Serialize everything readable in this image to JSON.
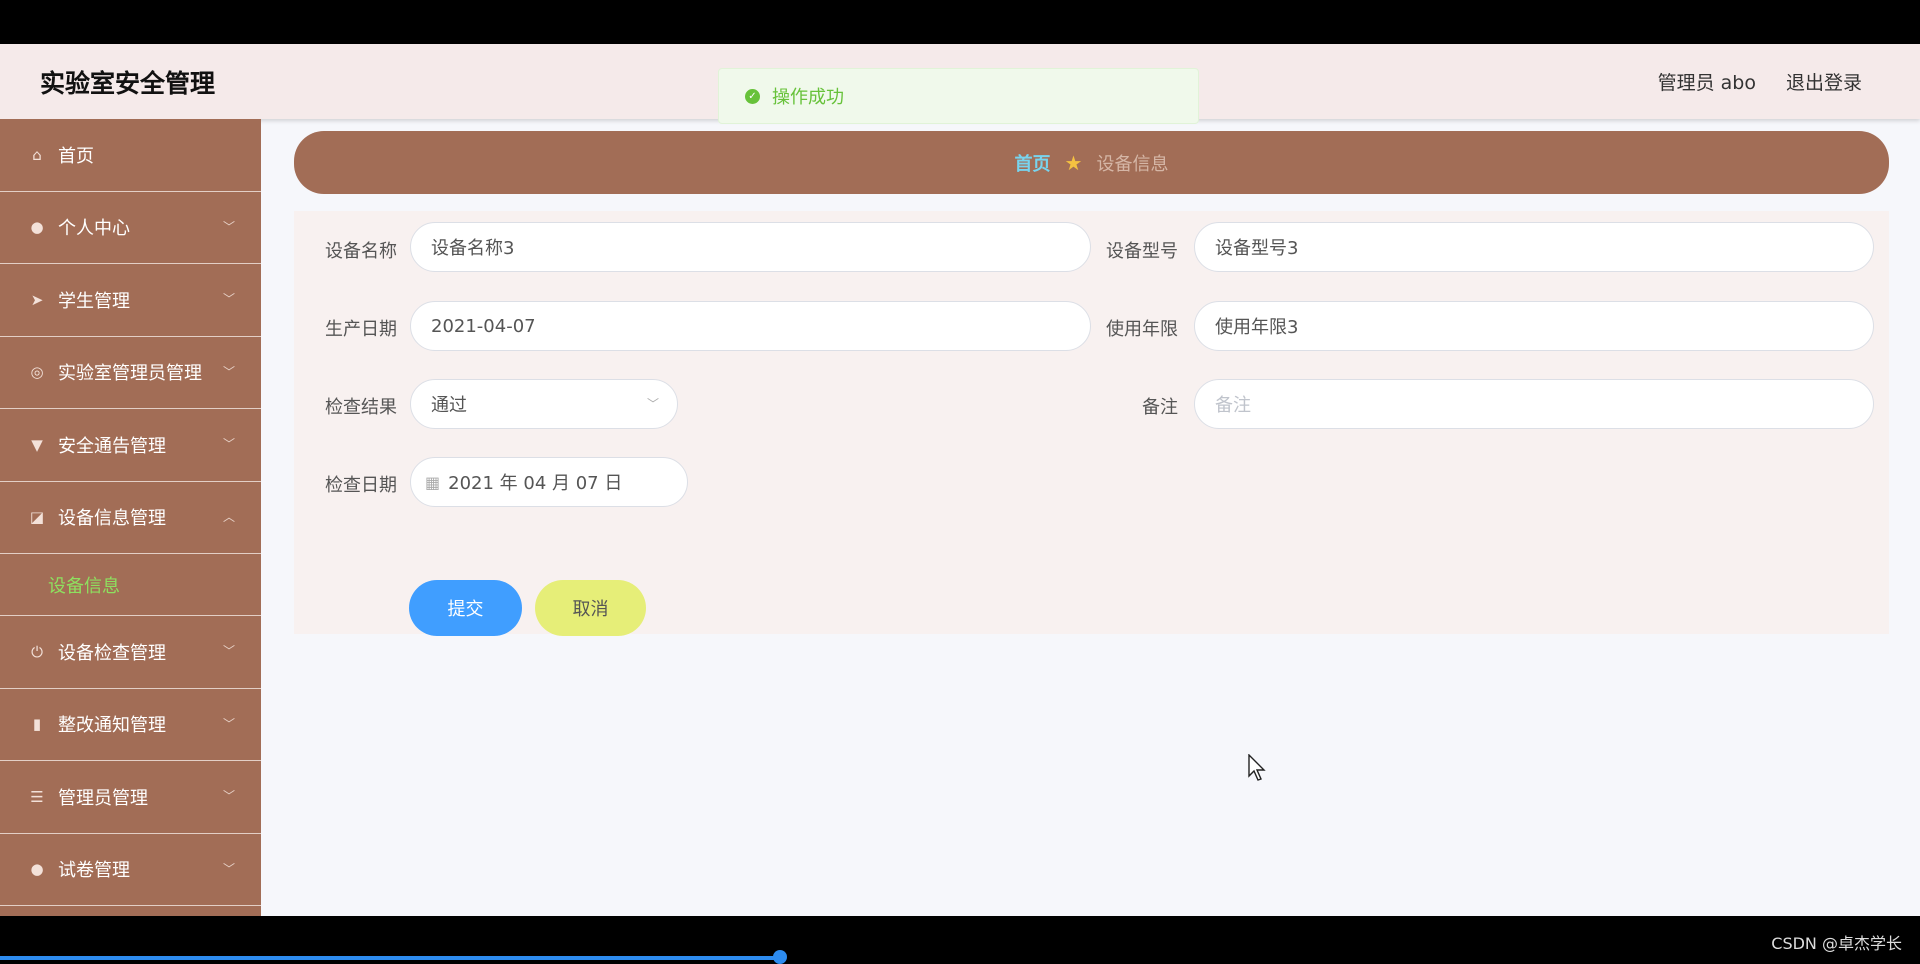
{
  "header": {
    "brand": "实验室安全管理",
    "user": "管理员 abo",
    "logout": "退出登录"
  },
  "toast": {
    "message": "操作成功"
  },
  "sidebar": {
    "items": [
      {
        "label": "首页",
        "icon": "home-icon",
        "glyph": "⌂"
      },
      {
        "label": "个人中心",
        "icon": "user-icon",
        "glyph": "●",
        "expandable": true
      },
      {
        "label": "学生管理",
        "icon": "send-icon",
        "glyph": "➤",
        "expandable": true
      },
      {
        "label": "实验室管理员管理",
        "icon": "gauge-icon",
        "glyph": "◎",
        "expandable": true
      },
      {
        "label": "安全通告管理",
        "icon": "pin-icon",
        "glyph": "▼",
        "expandable": true
      },
      {
        "label": "设备信息管理",
        "icon": "share-icon",
        "glyph": "◪",
        "expandable": true,
        "expanded": true
      },
      {
        "label": "设备检查管理",
        "icon": "power-icon",
        "glyph": "⏻",
        "expandable": true
      },
      {
        "label": "整改通知管理",
        "icon": "bar-chart-icon",
        "glyph": "▮",
        "expandable": true
      },
      {
        "label": "管理员管理",
        "icon": "sliders-icon",
        "glyph": "☰",
        "expandable": true
      },
      {
        "label": "试卷管理",
        "icon": "user-icon",
        "glyph": "●",
        "expandable": true
      }
    ],
    "submenu": {
      "label": "设备信息"
    }
  },
  "breadcrumb": {
    "home": "首页",
    "current": "设备信息"
  },
  "form": {
    "device_name": {
      "label": "设备名称",
      "value": "设备名称3"
    },
    "device_model": {
      "label": "设备型号",
      "value": "设备型号3"
    },
    "production_date": {
      "label": "生产日期",
      "value": "2021-04-07"
    },
    "service_life": {
      "label": "使用年限",
      "value": "使用年限3"
    },
    "check_result": {
      "label": "检查结果",
      "value": "通过"
    },
    "remark": {
      "label": "备注",
      "placeholder": "备注"
    },
    "check_date": {
      "label": "检查日期",
      "value": "2021 年 04 月 07 日"
    }
  },
  "buttons": {
    "submit": "提交",
    "cancel": "取消"
  },
  "watermark": "CSDN @卓杰学长",
  "colors": {
    "sidebar": "#a26d56",
    "accent_green": "#8ee05f",
    "submit": "#409eff",
    "cancel": "#e6ee78"
  }
}
